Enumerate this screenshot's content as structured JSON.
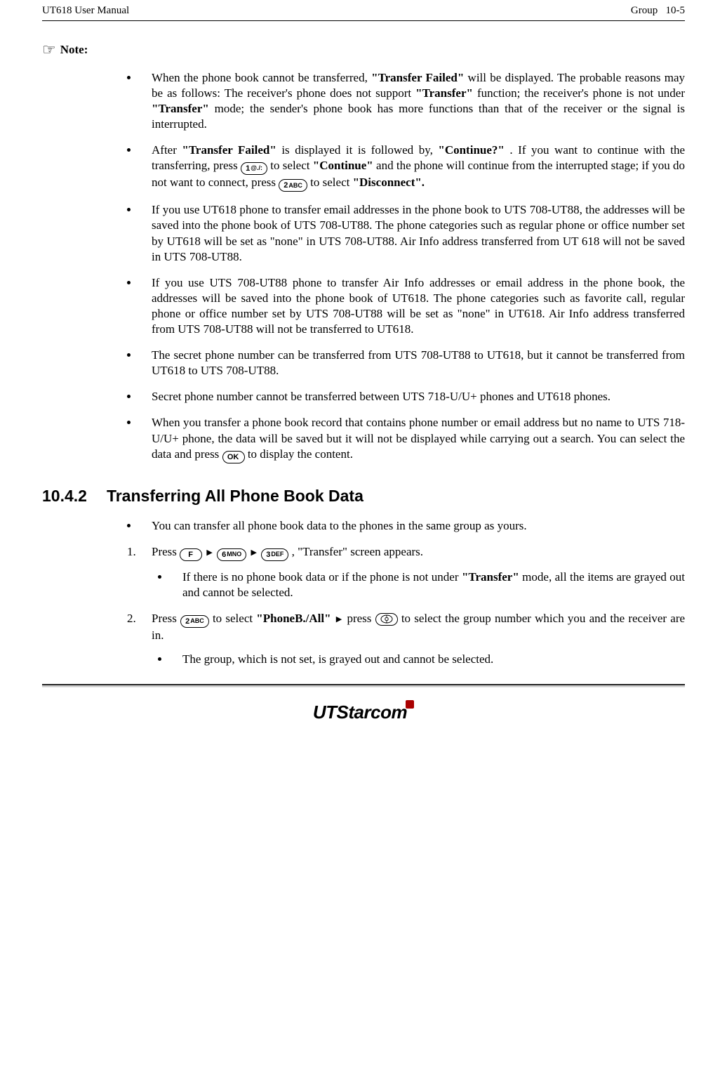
{
  "header": {
    "left": "UT618 User Manual",
    "right_label": "Group",
    "right_page": "10-5"
  },
  "note_label": "Note:",
  "icons": {
    "hand": "☞",
    "tri": "▶"
  },
  "keys": {
    "k1": {
      "big": "1",
      "small": "@./:"
    },
    "k2": {
      "big": "2",
      "small": "ABC"
    },
    "k3": {
      "big": "3",
      "small": "DEF"
    },
    "k6": {
      "big": "6",
      "small": "MNO"
    },
    "kF": {
      "big": "F",
      "small": ""
    },
    "kOK": {
      "big": "OK",
      "small": ""
    }
  },
  "bullets": [
    {
      "pre": "When the phone book cannot be transferred, ",
      "b1": "\"Transfer Failed\"",
      "mid": " will be displayed. The probable reasons may be as follows: The receiver's phone does not support ",
      "b2": "\"Transfer\"",
      "mid2": " function; the receiver's phone is not under ",
      "b3": "\"Transfer\"",
      "post": " mode; the sender's phone book has more functions than that of the receiver or the signal is interrupted."
    },
    {
      "pre": "After ",
      "b1": "\"Transfer Failed\"",
      "mid": " is displayed it is followed by, ",
      "b2": "\"Continue?\"",
      "mid2": " . If you want to continue with the transferring, press ",
      "mid3": " to select ",
      "b3": "\"Continue\"",
      "mid4": " and the phone will continue from the interrupted stage; if you do not want to connect, press ",
      "mid5": " to select ",
      "b4": "\"Disconnect\"."
    },
    {
      "text": "If you use UT618 phone to transfer email addresses in the phone book to UTS 708-UT88, the addresses will be saved into the phone book of UTS 708-UT88. The phone categories such as regular phone or office number set by UT618 will be set as \"none\" in UTS 708-UT88. Air Info address transferred from UT 618 will not be saved in UTS 708-UT88."
    },
    {
      "text": "If you use UTS 708-UT88 phone to transfer Air Info addresses or email address in the phone book, the addresses will be saved into the phone book of UT618. The phone categories such as favorite call, regular phone or office number set by UTS 708-UT88 will be set as \"none\" in UT618. Air Info address transferred from UTS 708-UT88 will not be transferred to UT618."
    },
    {
      "text": "The secret phone number can be transferred from UTS 708-UT88 to UT618, but it cannot be transferred from UT618 to UTS 708-UT88."
    },
    {
      "text": "Secret phone number cannot be transferred between UTS 718-U/U+ phones and UT618 phones."
    },
    {
      "pre": "When you transfer a phone book record that contains phone number or email address but no name to UTS 718-U/U+ phone, the data will be saved but it will not be displayed while carrying out a search. You can select the data and press ",
      "post": " to display the content."
    }
  ],
  "section": {
    "number": "10.4.2",
    "title": "Transferring All Phone Book Data"
  },
  "section_bullet": "You can transfer all phone book data to the phones in the same group as yours.",
  "steps": [
    {
      "pre": "Press ",
      "post": " , \"Transfer\" screen appears.",
      "sub": {
        "pre": "If there is no phone book data or if the phone is not under ",
        "b": "\"Transfer\"",
        "post": " mode, all the items are grayed out and cannot be selected."
      }
    },
    {
      "pre": "Press ",
      "mid": " to select ",
      "b1": "\"PhoneB./All\"",
      "mid2": " press ",
      "post": " to select the group number which you and the receiver are in.",
      "sub": {
        "text": "The group, which is not set, is grayed out and cannot be selected."
      }
    }
  ],
  "footer": {
    "logo": "UTStarcom"
  }
}
